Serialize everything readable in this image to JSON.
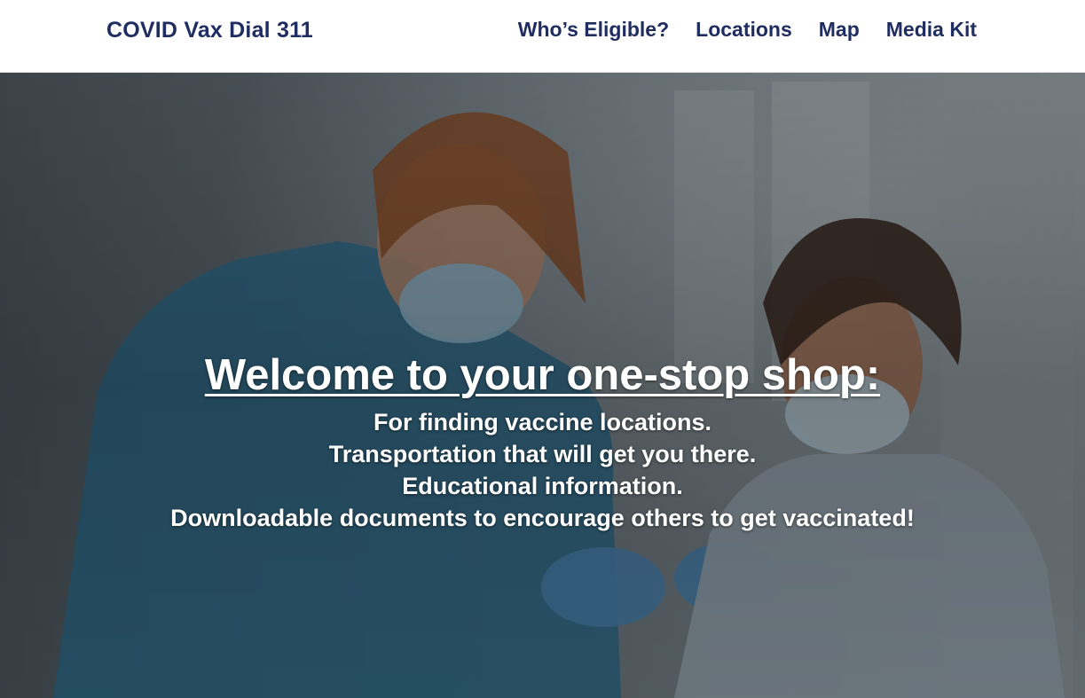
{
  "header": {
    "brand": "COVID Vax Dial 311",
    "nav": [
      {
        "label": "Who’s Eligible?"
      },
      {
        "label": "Locations"
      },
      {
        "label": "Map"
      },
      {
        "label": "Media Kit"
      }
    ]
  },
  "hero": {
    "headline": "Welcome to your one-stop shop:",
    "lines": [
      "For finding vaccine locations.",
      "Transportation that will get you there.",
      "Educational information.",
      "Downloadable documents to encourage others to get vaccinated!"
    ]
  },
  "colors": {
    "brand": "#1f2d61",
    "hero_text": "#ffffff"
  }
}
